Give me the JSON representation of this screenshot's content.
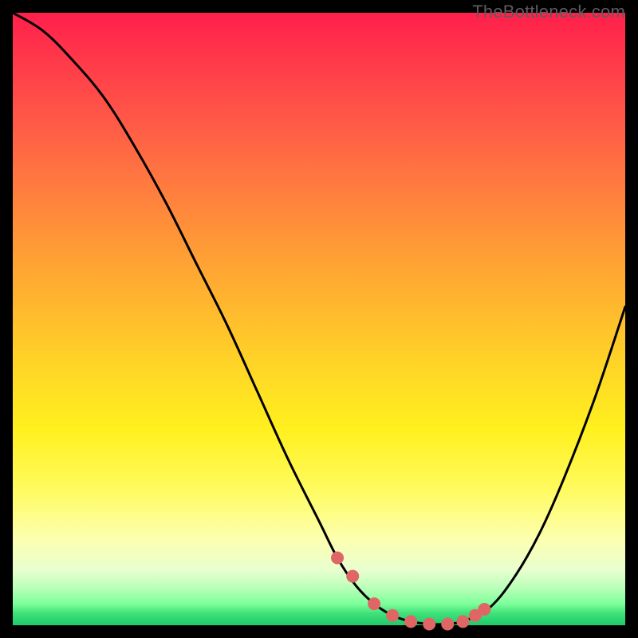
{
  "watermark": "TheBottleneck.com",
  "chart_data": {
    "type": "line",
    "title": "",
    "xlabel": "",
    "ylabel": "",
    "xlim": [
      0,
      100
    ],
    "ylim": [
      0,
      100
    ],
    "series": [
      {
        "name": "bottleneck-curve",
        "color": "#000000",
        "stroke_width": 3,
        "x": [
          0,
          5,
          10,
          15,
          20,
          25,
          30,
          35,
          40,
          45,
          50,
          53,
          56,
          59,
          62,
          65,
          68,
          71,
          74,
          78,
          82,
          86,
          90,
          95,
          100
        ],
        "y": [
          100,
          97,
          92,
          86,
          78,
          69,
          59,
          49,
          38,
          27,
          17,
          11,
          6.5,
          3.5,
          1.6,
          0.6,
          0.2,
          0.2,
          0.8,
          3.0,
          8.0,
          15,
          24,
          37,
          52
        ]
      },
      {
        "name": "optimal-range-markers",
        "color": "#e06666",
        "marker_radius": 8,
        "x": [
          53.0,
          55.5,
          59.0,
          62.0,
          65.0,
          68.0,
          71.0,
          73.5,
          75.5,
          77.0
        ],
        "y": [
          11.0,
          8.0,
          3.5,
          1.6,
          0.6,
          0.2,
          0.2,
          0.6,
          1.6,
          2.6
        ]
      }
    ],
    "background_gradient": {
      "top": "#ff1f4b",
      "upper_mid": "#ff9a36",
      "mid": "#fff01e",
      "lower_mid": "#e8ffd0",
      "bottom": "#1fc96a"
    }
  }
}
